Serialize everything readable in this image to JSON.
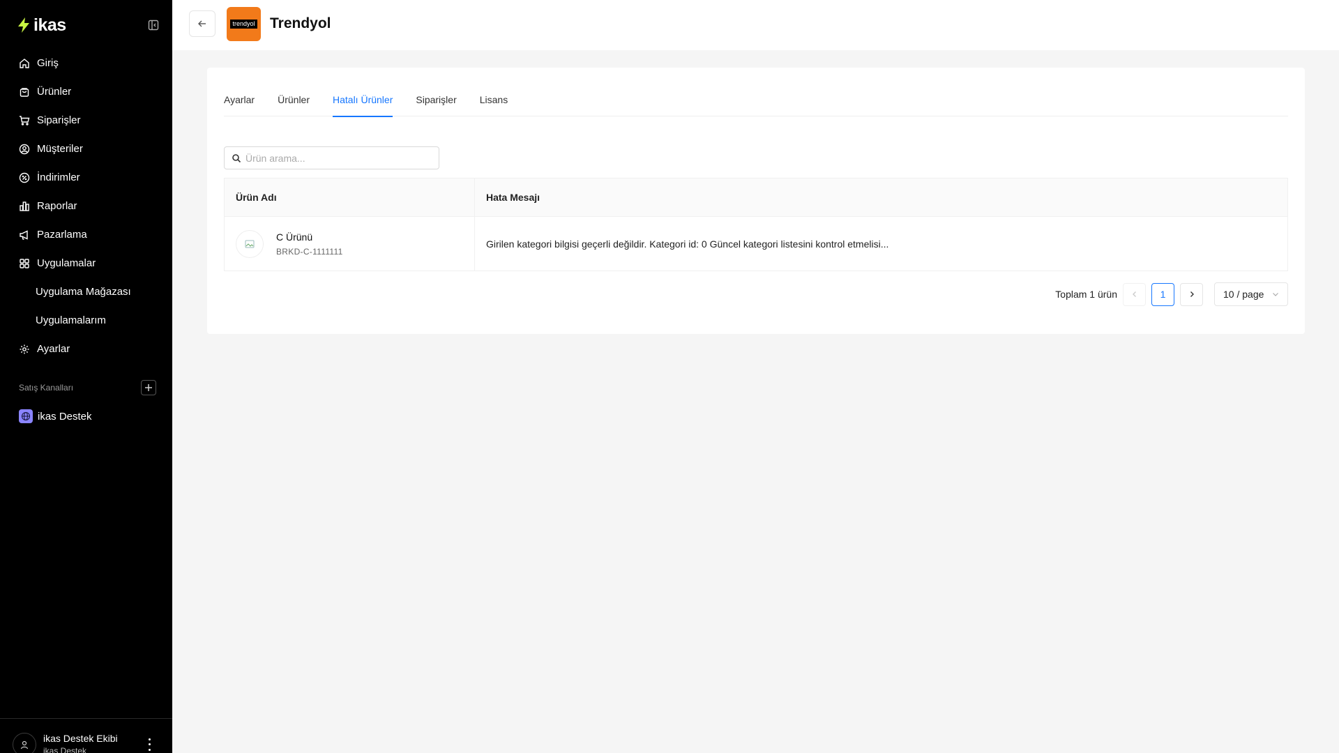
{
  "app": {
    "logo_text": "ikas"
  },
  "sidebar": {
    "items": [
      {
        "label": "Giriş",
        "icon": "home-icon"
      },
      {
        "label": "Ürünler",
        "icon": "bag-icon"
      },
      {
        "label": "Siparişler",
        "icon": "cart-icon"
      },
      {
        "label": "Müşteriler",
        "icon": "user-circle-icon"
      },
      {
        "label": "İndirimler",
        "icon": "discount-icon"
      },
      {
        "label": "Raporlar",
        "icon": "chart-icon"
      },
      {
        "label": "Pazarlama",
        "icon": "megaphone-icon"
      },
      {
        "label": "Uygulamalar",
        "icon": "grid-icon"
      },
      {
        "label": "Uygulama Mağazası"
      },
      {
        "label": "Uygulamalarım"
      },
      {
        "label": "Ayarlar",
        "icon": "gear-icon"
      }
    ],
    "section_label": "Satış Kanalları",
    "channel": {
      "label": "ikas Destek",
      "icon": "globe-icon"
    },
    "user": {
      "name": "ikas Destek Ekibi",
      "org": "ikas Destek"
    }
  },
  "header": {
    "title": "Trendyol",
    "brand_logo_text": "trendyol",
    "brand_color": "#f27a1a"
  },
  "tabs": [
    {
      "label": "Ayarlar",
      "active": false
    },
    {
      "label": "Ürünler",
      "active": false
    },
    {
      "label": "Hatalı Ürünler",
      "active": true
    },
    {
      "label": "Siparişler",
      "active": false
    },
    {
      "label": "Lisans",
      "active": false
    }
  ],
  "search": {
    "placeholder": "Ürün arama...",
    "value": ""
  },
  "table": {
    "columns": [
      "Ürün Adı",
      "Hata Mesajı"
    ],
    "rows": [
      {
        "name": "C Ürünü",
        "sku": "BRKD-C-1111111",
        "error": "Girilen kategori bilgisi geçerli değildir. Kategori id: 0 Güncel kategori listesini kontrol etmelisi..."
      }
    ]
  },
  "pagination": {
    "total_text": "Toplam 1 ürün",
    "current_page": "1",
    "page_size": "10 / page"
  },
  "colors": {
    "accent": "#1677ff",
    "sidebar_bg": "#000000",
    "page_bg": "#f5f5f5"
  }
}
